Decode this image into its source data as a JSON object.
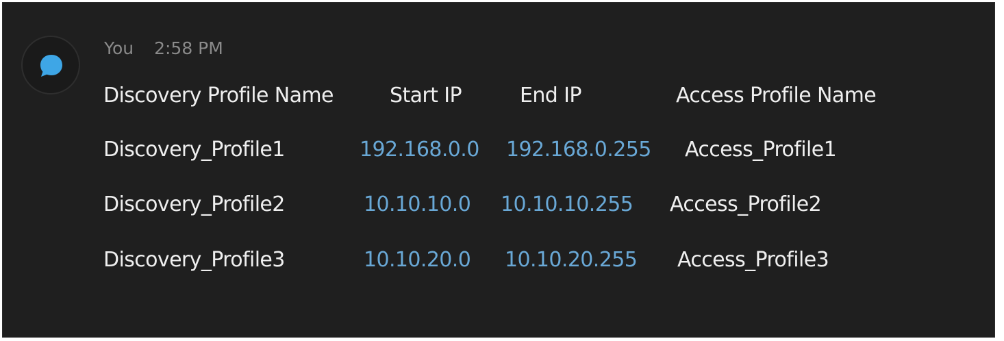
{
  "message": {
    "author": "You",
    "time": "2:58 PM",
    "avatar_icon": "chat-bubble-icon",
    "accent_color": "#3ea6e6",
    "ip_color": "#69a8d6"
  },
  "table": {
    "headers": [
      "Discovery Profile Name",
      "Start IP",
      "End IP",
      "Access Profile Name"
    ],
    "rows": [
      [
        "Discovery_Profile1",
        "192.168.0.0",
        "192.168.0.255",
        "Access_Profile1"
      ],
      [
        "Discovery_Profile2",
        "10.10.10.0",
        "10.10.10.255",
        "Access_Profile2"
      ],
      [
        "Discovery_Profile3",
        "10.10.20.0",
        "10.10.20.255",
        "Access_Profile3"
      ]
    ]
  }
}
